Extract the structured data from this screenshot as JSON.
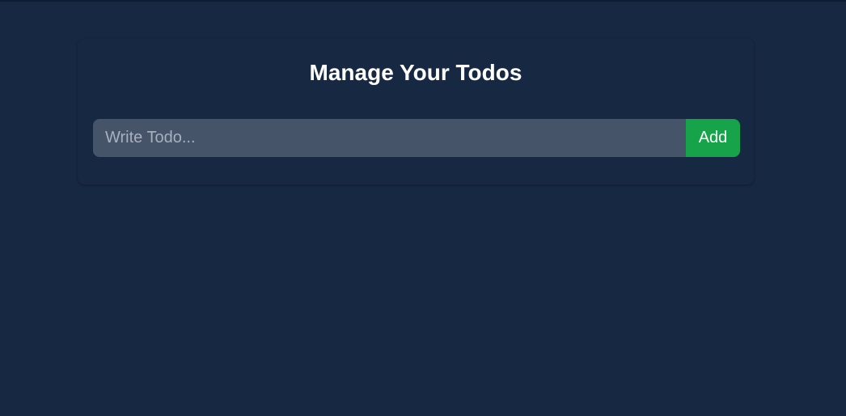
{
  "todo_app": {
    "title": "Manage Your Todos",
    "input": {
      "value": "",
      "placeholder": "Write Todo..."
    },
    "add_button_label": "Add"
  },
  "colors": {
    "background": "#172842",
    "input_background": "#455469",
    "add_button": "#16a34a",
    "text": "#ffffff"
  }
}
